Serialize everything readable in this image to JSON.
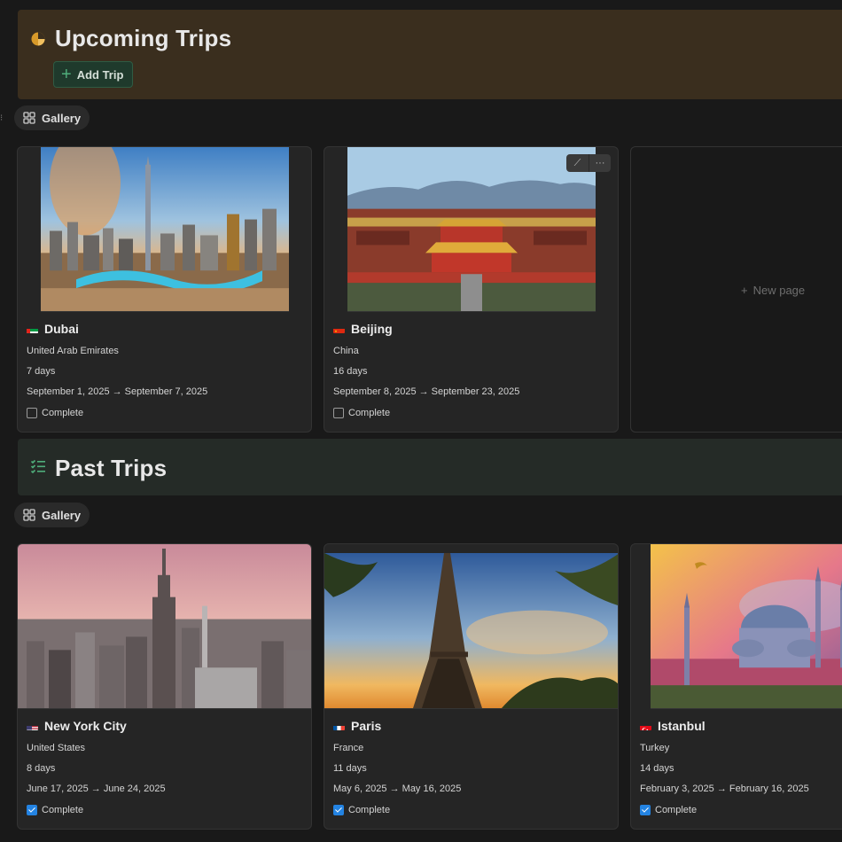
{
  "upcoming": {
    "title": "Upcoming Trips",
    "add_button": "Add Trip",
    "view_tab": "Gallery",
    "icon": "pie-chart-icon",
    "cards": [
      {
        "title": "Dubai",
        "country": "United Arab Emirates",
        "duration": "7 days",
        "dates": "September 1, 2025 → September 7, 2025",
        "status": "Complete",
        "checked": false
      },
      {
        "title": "Beijing",
        "country": "China",
        "duration": "16 days",
        "dates": "September 8, 2025 → September 23, 2025",
        "status": "Complete",
        "checked": false
      }
    ],
    "new_page": "New page"
  },
  "past": {
    "title": "Past Trips",
    "view_tab": "Gallery",
    "icon": "checklist-icon",
    "cards": [
      {
        "title": "New York City",
        "country": "United States",
        "duration": "8 days",
        "dates": "June 17, 2025 → June 24, 2025",
        "status": "Complete",
        "checked": true
      },
      {
        "title": "Paris",
        "country": "France",
        "duration": "11 days",
        "dates": "May 6, 2025 → May 16, 2025",
        "status": "Complete",
        "checked": true
      },
      {
        "title": "Istanbul",
        "country": "Turkey",
        "duration": "14 days",
        "dates": "February 3, 2025 → February 16, 2025",
        "status": "Complete",
        "checked": true
      }
    ]
  },
  "colors": {
    "upcoming_header_bg": "#3a2e1e",
    "past_header_bg": "#252b27",
    "accent_green": "#4fae7b",
    "checkbox_blue": "#2383e2"
  }
}
